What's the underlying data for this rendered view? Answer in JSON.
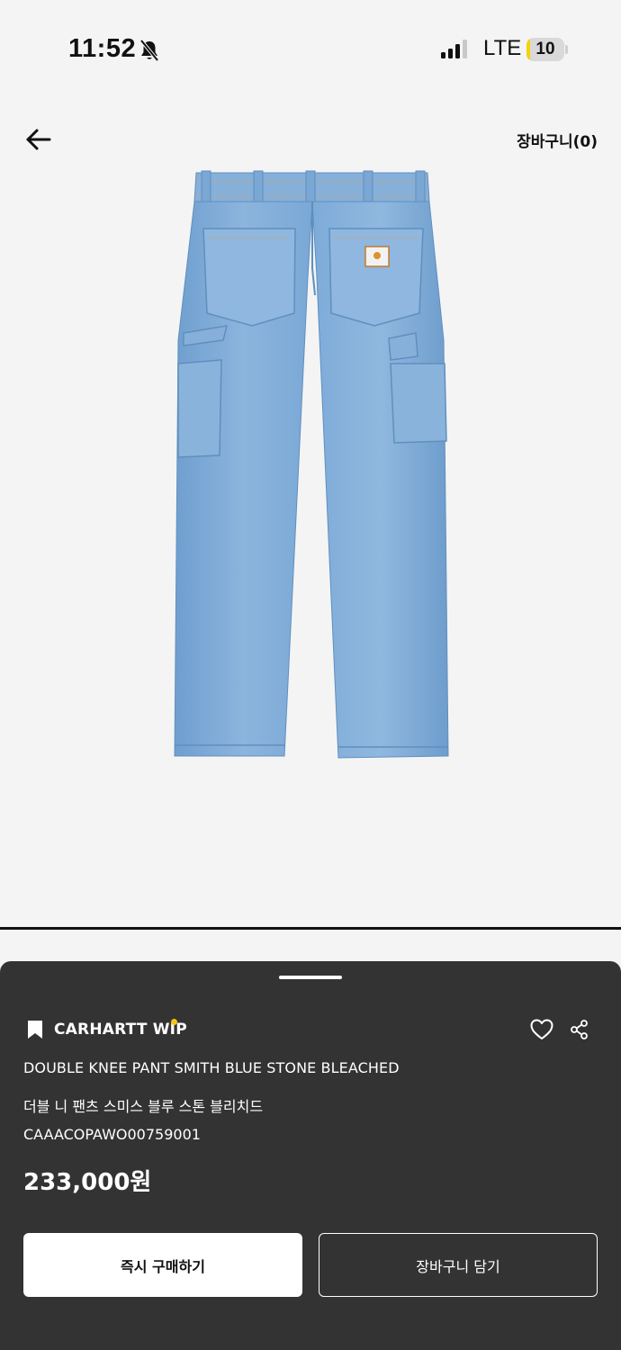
{
  "status_bar": {
    "time": "11:52",
    "network": "LTE",
    "battery_level": "10",
    "battery_fraction": 0.1,
    "icons": [
      "bell-off-icon",
      "signal-icon",
      "battery-icon"
    ]
  },
  "header": {
    "back_icon": "arrow-left-icon",
    "cart_label": "장바구니(0)"
  },
  "product": {
    "image": "light-blue denim double-knee carpenter pants, back view",
    "brand": "CARHARTT WIP",
    "name_en": "DOUBLE KNEE PANT SMITH BLUE STONE BLEACHED",
    "name_ko": "더블 니 팬츠 스미스 블루 스톤 블리치드",
    "code": "CAAACOPAWO00759001",
    "price": "233,000원"
  },
  "actions": {
    "buy_now_label": "즉시 구매하기",
    "add_to_cart_label": "장바구니 담기",
    "wishlist_icon": "heart-icon",
    "share_icon": "share-icon",
    "bookmark_icon": "bookmark-icon"
  },
  "colors": {
    "page_background": "#f4f4f4",
    "sheet_background": "#333333",
    "brand_dot": "#f5c518",
    "battery_fill": "#f5d20a",
    "denim": "#7ea9d6"
  }
}
